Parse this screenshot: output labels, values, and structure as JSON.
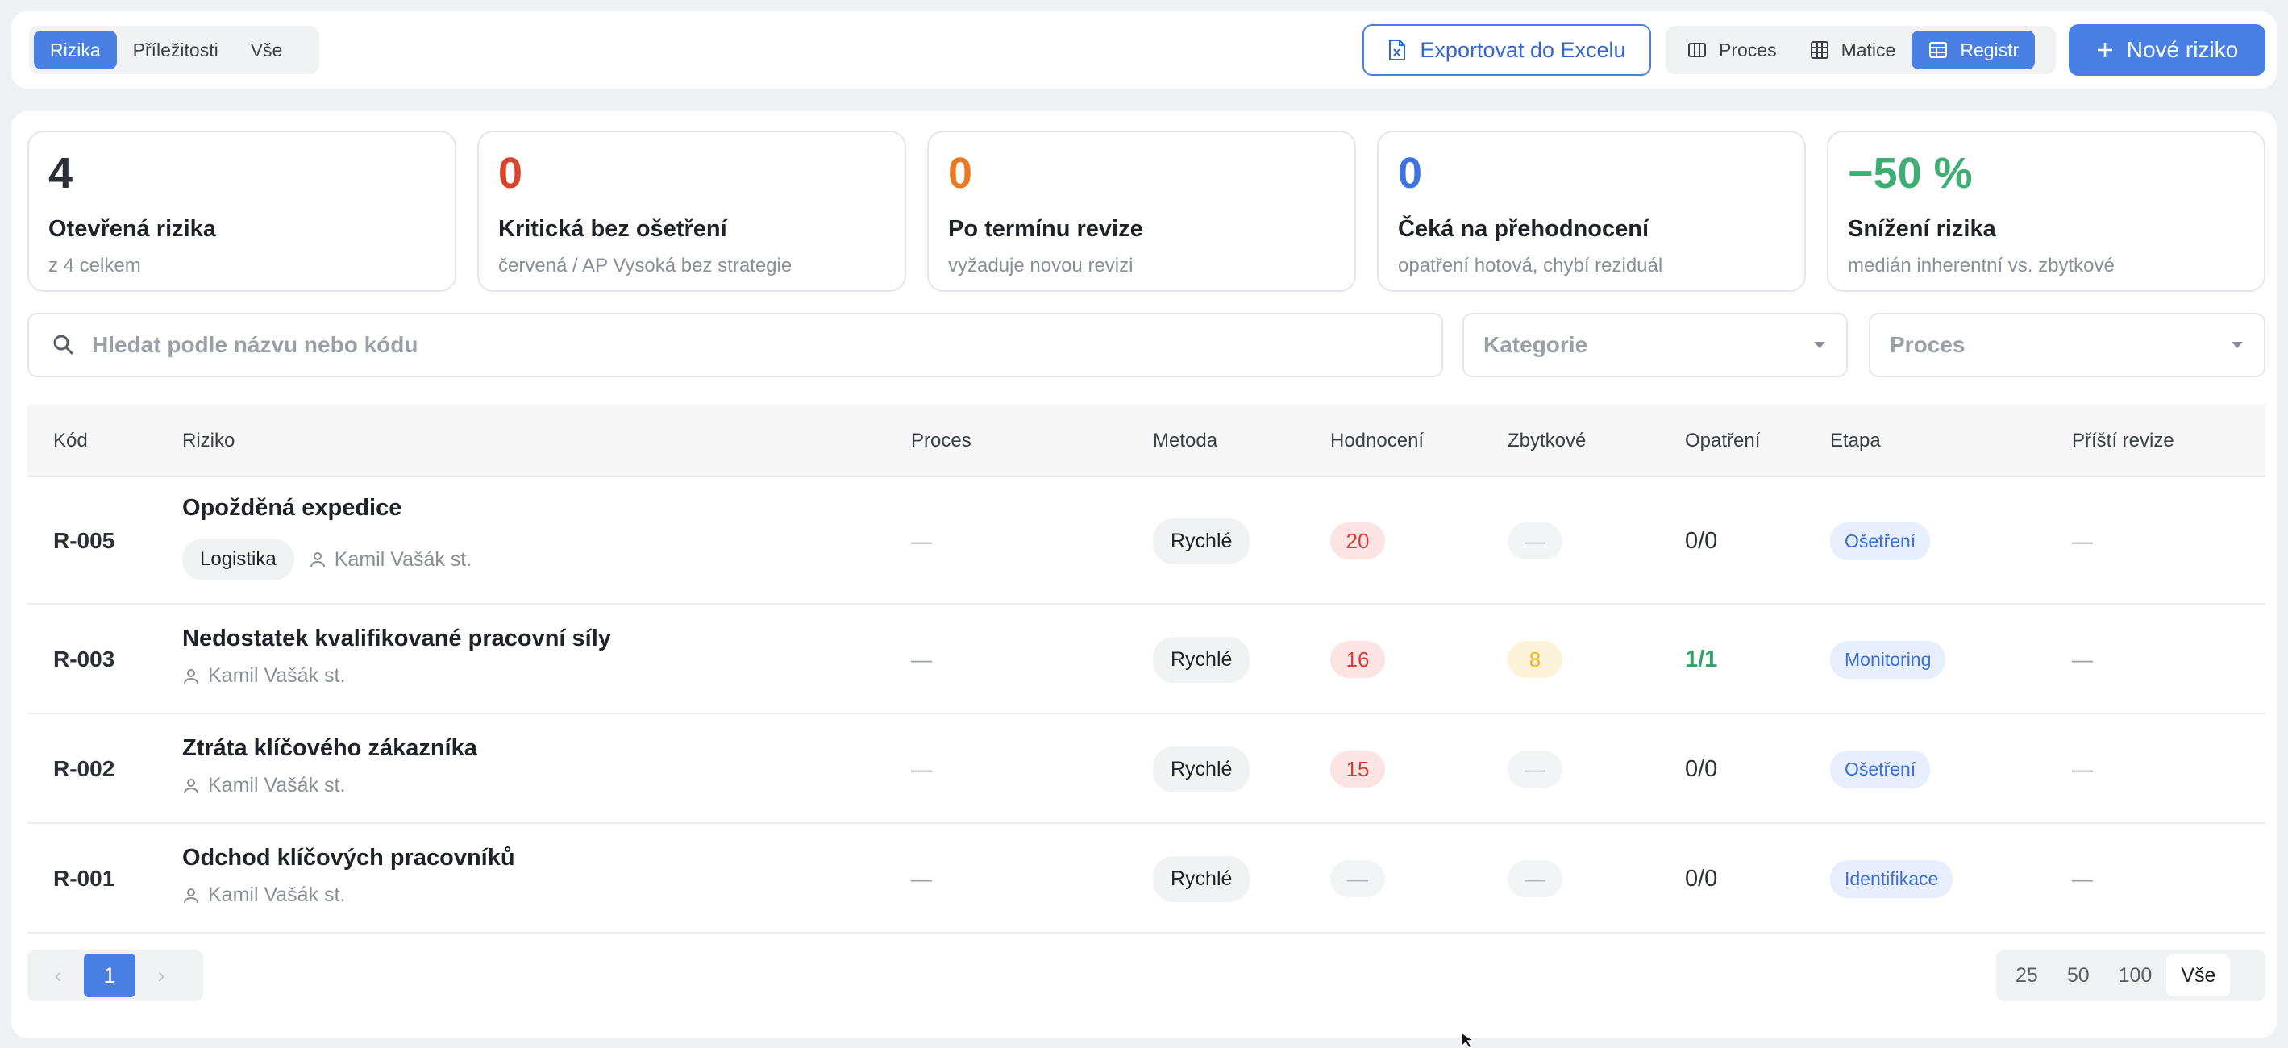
{
  "tabs": [
    "Rizika",
    "Příležitosti",
    "Vše"
  ],
  "actions": {
    "export_label": "Exportovat do Excelu",
    "views": [
      "Proces",
      "Matice",
      "Registr"
    ],
    "new_label": "Nové riziko"
  },
  "stats": [
    {
      "value": "4",
      "label": "Otevřená rizika",
      "sub": "z 4 celkem",
      "color": "#1f2329"
    },
    {
      "value": "0",
      "label": "Kritická bez ošetření",
      "sub": "červená / AP Vysoká bez strategie",
      "color": "#d9442f"
    },
    {
      "value": "0",
      "label": "Po termínu revize",
      "sub": "vyžaduje novou revizi",
      "color": "#ea7a22"
    },
    {
      "value": "0",
      "label": "Čeká na přehodnocení",
      "sub": "opatření hotová, chybí reziduál",
      "color": "#3f74e0"
    },
    {
      "value": "−50 %",
      "label": "Snížení rizika",
      "sub": "medián inherentní vs. zbytkové",
      "color": "#3fae74"
    }
  ],
  "filters": {
    "search_placeholder": "Hledat podle názvu nebo kódu",
    "category_placeholder": "Kategorie",
    "process_placeholder": "Proces"
  },
  "table": {
    "headers": [
      "Kód",
      "Riziko",
      "Proces",
      "Metoda",
      "Hodnocení",
      "Zbytkové",
      "Opatření",
      "Etapa",
      "Příští revize"
    ],
    "rows": [
      {
        "code": "R-005",
        "title": "Opožděná expedice",
        "tag": "Logistika",
        "owner": "Kamil Vašák st.",
        "process": "—",
        "method": "Rychlé",
        "score": "20",
        "residual": "—",
        "measures": "0/0",
        "stage": "Ošetření",
        "review": "—"
      },
      {
        "code": "R-003",
        "title": "Nedostatek kvalifikované pracovní síly",
        "tag": "",
        "owner": "Kamil Vašák st.",
        "process": "—",
        "method": "Rychlé",
        "score": "16",
        "residual": "8",
        "measures": "1/1",
        "stage": "Monitoring",
        "review": "—"
      },
      {
        "code": "R-002",
        "title": "Ztráta klíčového zákazníka",
        "tag": "",
        "owner": "Kamil Vašák st.",
        "process": "—",
        "method": "Rychlé",
        "score": "15",
        "residual": "—",
        "measures": "0/0",
        "stage": "Ošetření",
        "review": "—"
      },
      {
        "code": "R-001",
        "title": "Odchod klíčových pracovníků",
        "tag": "",
        "owner": "Kamil Vašák st.",
        "process": "—",
        "method": "Rychlé",
        "score": "—",
        "residual": "—",
        "measures": "0/0",
        "stage": "Identifikace",
        "review": "—"
      }
    ]
  },
  "pagination": {
    "prev": "‹",
    "current": "1",
    "next": "›",
    "page_sizes": [
      "25",
      "50",
      "100",
      "Vše"
    ]
  }
}
